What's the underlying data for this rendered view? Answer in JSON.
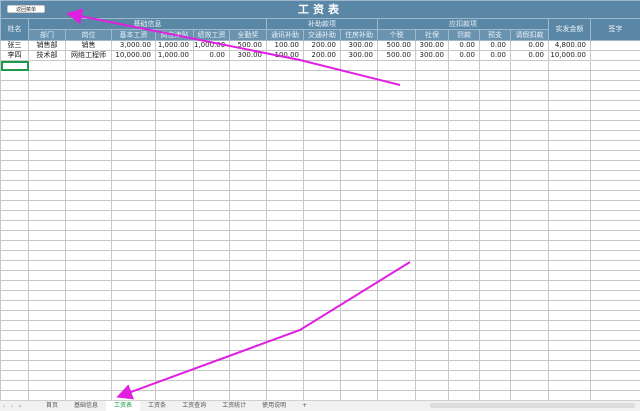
{
  "title": "工资表",
  "back_button": "返回菜单",
  "groups": {
    "name": "姓名",
    "basic": "基础信息",
    "subsidy": "补助款项",
    "deduct": "应扣款项",
    "net": "实发金额",
    "sign": "签字"
  },
  "columns": [
    "部门",
    "岗位",
    "基本工资",
    "岗位津贴",
    "绩效工资",
    "全勤奖",
    "通讯补助",
    "交通补助",
    "住房补助",
    "个税",
    "社保",
    "罚款",
    "预支",
    "请假扣款"
  ],
  "rows": [
    [
      "张三",
      "销售部",
      "销售",
      "3,000.00",
      "1,000.00",
      "1,000.00",
      "500.00",
      "100.00",
      "200.00",
      "300.00",
      "500.00",
      "300.00",
      "0.00",
      "0.00",
      "0.00",
      "4,800.00",
      ""
    ],
    [
      "李四",
      "技术部",
      "网络工程师",
      "10,000.00",
      "1,000.00",
      "0.00",
      "300.00",
      "100.00",
      "200.00",
      "300.00",
      "500.00",
      "300.00",
      "0.00",
      "0.00",
      "0.00",
      "10,000.00",
      ""
    ]
  ],
  "sheet_tabs": [
    "首页",
    "基础信息",
    "工资表",
    "工资条",
    "工资查询",
    "工资统计",
    "使用说明"
  ],
  "active_tab": "工资表",
  "add_sheet": "+",
  "colors": {
    "header": "#5b87a6",
    "active_tab": "#1a9a4a",
    "arrow": "#e020e0"
  }
}
